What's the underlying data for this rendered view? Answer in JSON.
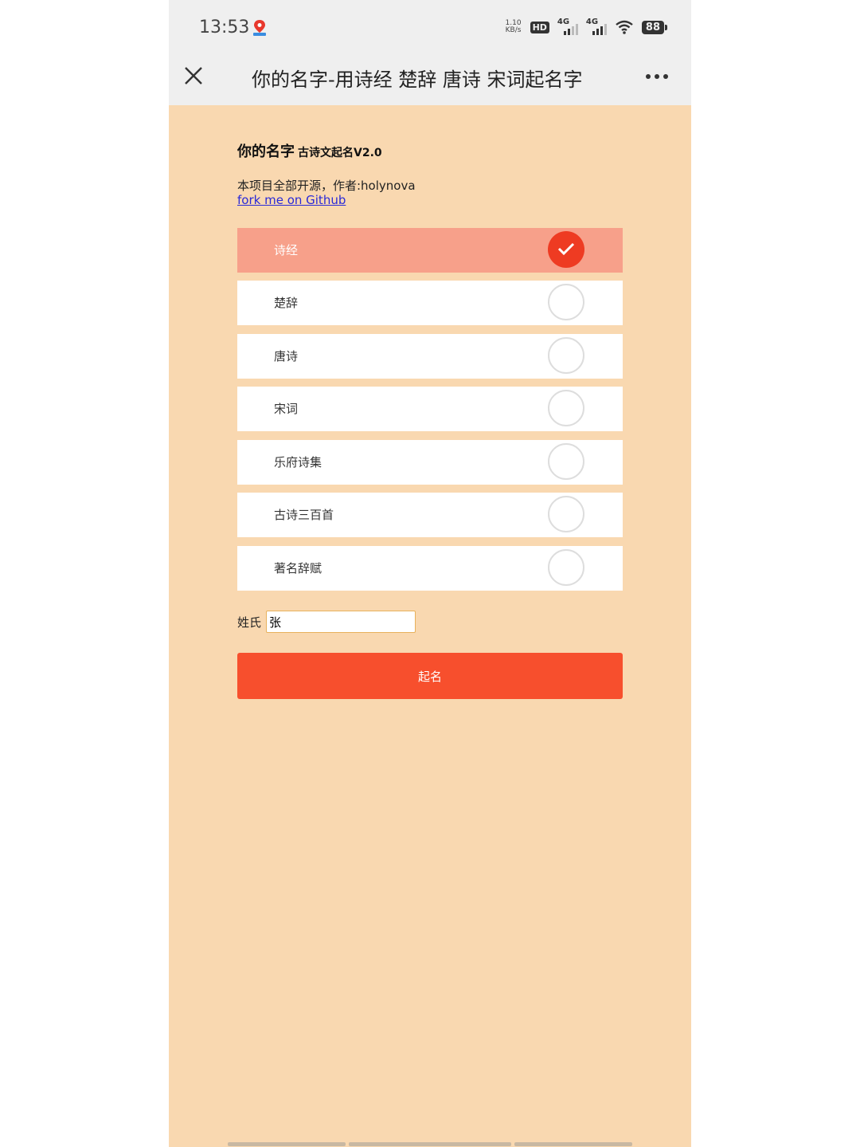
{
  "status_bar": {
    "time": "13:53",
    "net_speed": "1.10\nKB/s",
    "hd": "HD",
    "signal_1": "4G",
    "signal_2": "4G",
    "battery": "88"
  },
  "nav": {
    "title": "你的名字-用诗经 楚辞 唐诗 宋词起名字"
  },
  "header": {
    "title": "你的名字",
    "subtitle": "古诗文起名V2.0",
    "description": "本项目全部开源，作者:holynova",
    "github_link": "fork me on Github"
  },
  "options": [
    {
      "label": "诗经",
      "selected": true
    },
    {
      "label": "楚辞",
      "selected": false
    },
    {
      "label": "唐诗",
      "selected": false
    },
    {
      "label": "宋词",
      "selected": false
    },
    {
      "label": "乐府诗集",
      "selected": false
    },
    {
      "label": "古诗三百首",
      "selected": false
    },
    {
      "label": "著名辞赋",
      "selected": false
    }
  ],
  "form": {
    "surname_label": "姓氏",
    "surname_value": "张",
    "submit_label": "起名"
  },
  "colors": {
    "background": "#f9d8b0",
    "selected_row": "#f7a08a",
    "accent": "#f74f2d"
  }
}
